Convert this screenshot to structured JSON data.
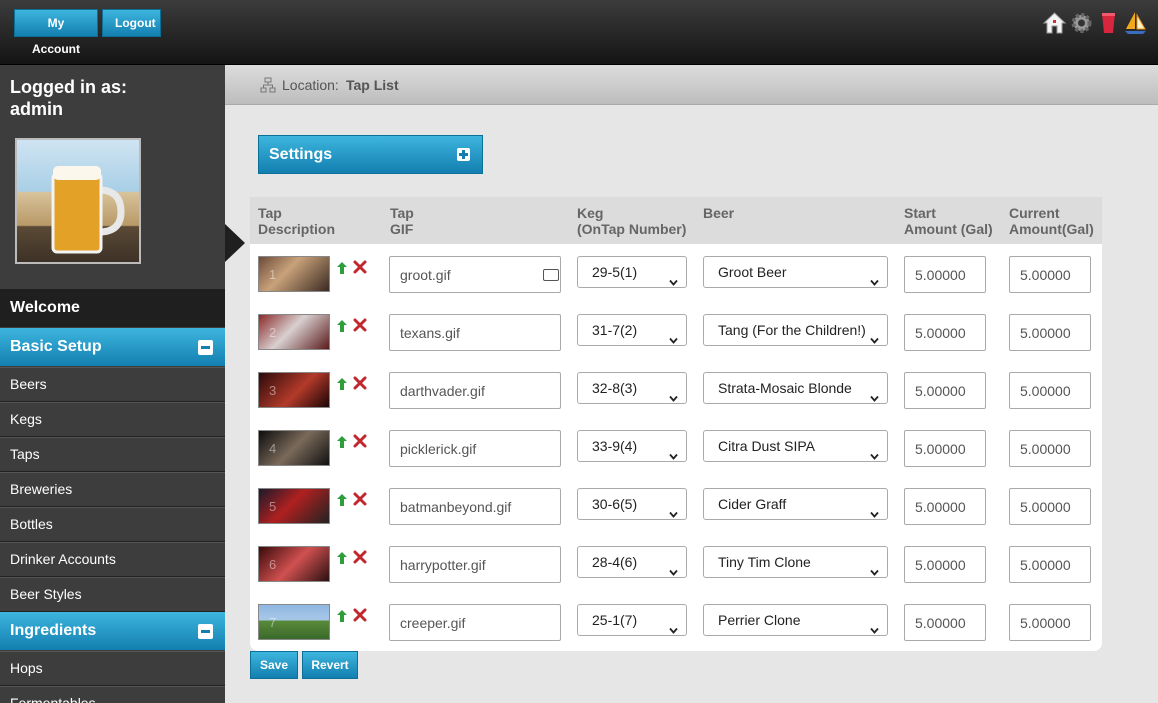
{
  "header": {
    "my_account_label": "My Account",
    "logout_label": "Logout",
    "icons": [
      "home-icon",
      "gear-icon",
      "cup-icon",
      "sailboat-icon"
    ]
  },
  "sidebar": {
    "logged_in_label": "Logged in as:",
    "username": "admin",
    "welcome_label": "Welcome",
    "basic_setup": {
      "title": "Basic Setup",
      "items": [
        "Beers",
        "Kegs",
        "Taps",
        "Breweries",
        "Bottles",
        "Drinker Accounts",
        "Beer Styles"
      ]
    },
    "ingredients": {
      "title": "Ingredients",
      "items": [
        "Hops",
        "Fermentables"
      ]
    }
  },
  "location": {
    "label": "Location:",
    "value": "Tap List"
  },
  "settings": {
    "title": "Settings"
  },
  "table": {
    "headers": {
      "tap_description": [
        "Tap",
        "Description"
      ],
      "tap_gif": [
        "Tap",
        "GIF"
      ],
      "keg": [
        "Keg",
        "(OnTap Number)"
      ],
      "beer": [
        "Beer"
      ],
      "start_amount": [
        "Start",
        "Amount (Gal)"
      ],
      "current_amount": [
        "Current",
        "Amount(Gal)"
      ]
    },
    "rows": [
      {
        "num": "1",
        "gif": "groot.gif",
        "keg": "29-5(1)",
        "beer": "Groot Beer",
        "start": "5.00000",
        "current": "5.00000"
      },
      {
        "num": "2",
        "gif": "texans.gif",
        "keg": "31-7(2)",
        "beer": "Tang (For the Children!)",
        "start": "5.00000",
        "current": "5.00000"
      },
      {
        "num": "3",
        "gif": "darthvader.gif",
        "keg": "32-8(3)",
        "beer": "Strata-Mosaic Blonde",
        "start": "5.00000",
        "current": "5.00000"
      },
      {
        "num": "4",
        "gif": "picklerick.gif",
        "keg": "33-9(4)",
        "beer": "Citra Dust SIPA",
        "start": "5.00000",
        "current": "5.00000"
      },
      {
        "num": "5",
        "gif": "batmanbeyond.gif",
        "keg": "30-6(5)",
        "beer": "Cider Graff",
        "start": "5.00000",
        "current": "5.00000"
      },
      {
        "num": "6",
        "gif": "harrypotter.gif",
        "keg": "28-4(6)",
        "beer": "Tiny Tim Clone",
        "start": "5.00000",
        "current": "5.00000"
      },
      {
        "num": "7",
        "gif": "creeper.gif",
        "keg": "25-1(7)",
        "beer": "Perrier Clone",
        "start": "5.00000",
        "current": "5.00000"
      }
    ]
  },
  "buttons": {
    "save_label": "Save",
    "revert_label": "Revert"
  },
  "colors": {
    "accent": "#2a9ccb",
    "sidebar": "#3d3d3d",
    "move_up": "#2e9e3a",
    "delete": "#c0282d"
  }
}
